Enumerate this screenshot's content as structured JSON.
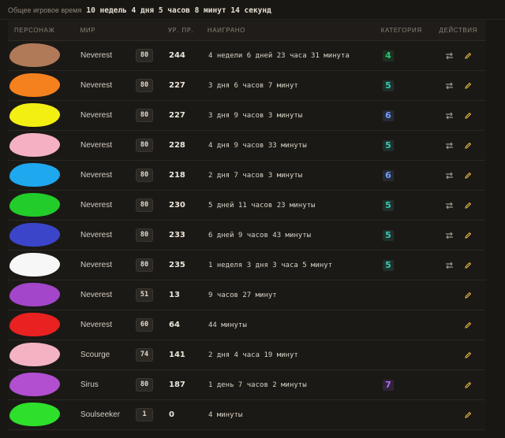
{
  "header": {
    "total_time_label": "Общее игровое время",
    "total_time_value": "10 недель 4 дня 5 часов 8 минут 14 секунд"
  },
  "columns": {
    "character": "ПЕРСОНАЖ",
    "world": "МИР",
    "rp_level": "УР. ПР.",
    "played": "НАИГРАНО",
    "category": "КАТЕГОРИЯ",
    "actions": "ДЕЙСТВИЯ"
  },
  "colors": {
    "cat_4": "#2fc36a",
    "cat_5": "#3ec8b4",
    "cat_6": "#6fa0ff",
    "cat_7": "#b46bff",
    "edit_icon": "#e0b640",
    "swap_icon": "#9a9388"
  },
  "rows": [
    {
      "avatar_color": "#b07a58",
      "world": "Neverest",
      "level": "80",
      "rp": "244",
      "played": "4 недели 6 дней 23 часа 31 минута",
      "category": "4",
      "category_color": "#2fc36a",
      "has_swap": true
    },
    {
      "avatar_color": "#f5811e",
      "world": "Neverest",
      "level": "80",
      "rp": "227",
      "played": "3 дня 6 часов 7 минут",
      "category": "5",
      "category_color": "#3ec8b4",
      "has_swap": true
    },
    {
      "avatar_color": "#f4ef12",
      "world": "Neverest",
      "level": "80",
      "rp": "227",
      "played": "3 дня 9 часов 3 минуты",
      "category": "6",
      "category_color": "#6fa0ff",
      "has_swap": true
    },
    {
      "avatar_color": "#f5b0c4",
      "world": "Neverest",
      "level": "80",
      "rp": "228",
      "played": "4 дня 9 часов 33 минуты",
      "category": "5",
      "category_color": "#3ec8b4",
      "has_swap": true
    },
    {
      "avatar_color": "#1ea8ee",
      "world": "Neverest",
      "level": "80",
      "rp": "218",
      "played": "2 дня 7 часов 3 минуты",
      "category": "6",
      "category_color": "#6fa0ff",
      "has_swap": true
    },
    {
      "avatar_color": "#22cc2a",
      "world": "Neverest",
      "level": "80",
      "rp": "230",
      "played": "5 дней 11 часов 23 минуты",
      "category": "5",
      "category_color": "#3ec8b4",
      "has_swap": true
    },
    {
      "avatar_color": "#3b45c9",
      "world": "Neverest",
      "level": "80",
      "rp": "233",
      "played": "6 дней 9 часов 43 минуты",
      "category": "5",
      "category_color": "#3ec8b4",
      "has_swap": true
    },
    {
      "avatar_color": "#f7f7f7",
      "world": "Neverest",
      "level": "80",
      "rp": "235",
      "played": "1 неделя 3 дня 3 часа 5 минут",
      "category": "5",
      "category_color": "#3ec8b4",
      "has_swap": true
    },
    {
      "avatar_color": "#a346c9",
      "world": "Neverest",
      "level": "51",
      "rp": "13",
      "played": "9 часов 27 минут",
      "category": "",
      "category_color": "",
      "has_swap": false
    },
    {
      "avatar_color": "#ea2121",
      "world": "Neverest",
      "level": "60",
      "rp": "64",
      "played": "44 минуты",
      "category": "",
      "category_color": "",
      "has_swap": false
    },
    {
      "avatar_color": "#f4b3c3",
      "world": "Scourge",
      "level": "74",
      "rp": "141",
      "played": "2 дня 4 часа 19 минут",
      "category": "",
      "category_color": "",
      "has_swap": false
    },
    {
      "avatar_color": "#b14fd0",
      "world": "Sirus",
      "level": "80",
      "rp": "187",
      "played": "1 день 7 часов 2 минуты",
      "category": "7",
      "category_color": "#b46bff",
      "has_swap": false
    },
    {
      "avatar_color": "#2ee02b",
      "world": "Soulseeker",
      "level": "1",
      "rp": "0",
      "played": "4 минуты",
      "category": "",
      "category_color": "",
      "has_swap": false
    }
  ]
}
